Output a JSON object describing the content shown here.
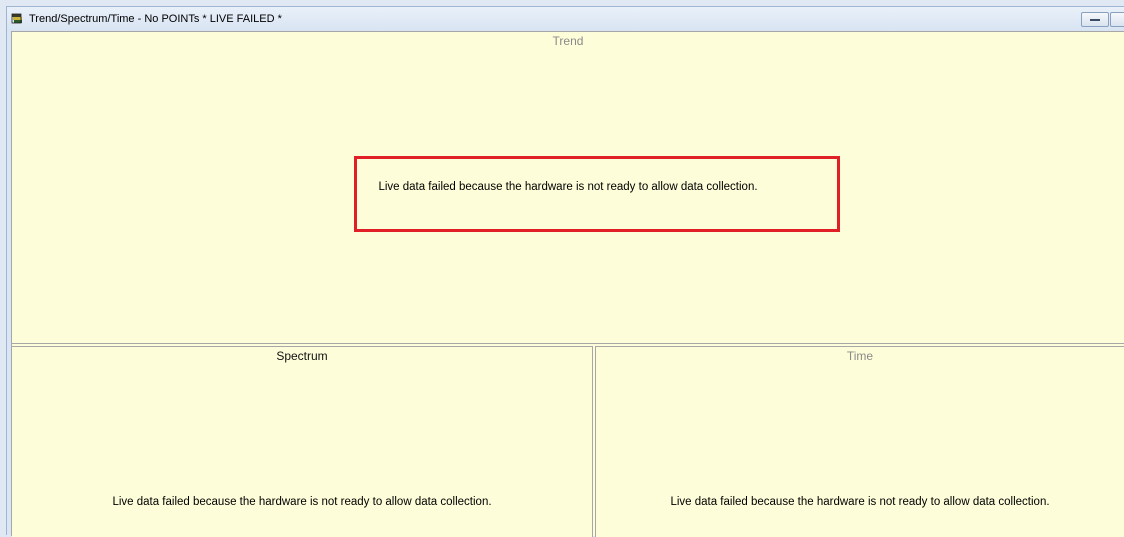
{
  "window": {
    "title": "Trend/Spectrum/Time - No POINTs * LIVE FAILED *",
    "icon": "app-icon"
  },
  "panes": {
    "trend": {
      "title": "Trend",
      "message": "Live data failed because the hardware is not ready to allow data collection."
    },
    "spectrum": {
      "title": "Spectrum",
      "message": "Live data failed because the hardware is not ready to allow data collection."
    },
    "time": {
      "title": "Time",
      "message": "Live data failed because the hardware is not ready to allow data collection."
    }
  },
  "colors": {
    "pane_background": "#fdfdd9",
    "highlight_border": "#e01f26",
    "titlebar": "#dae6f4"
  }
}
